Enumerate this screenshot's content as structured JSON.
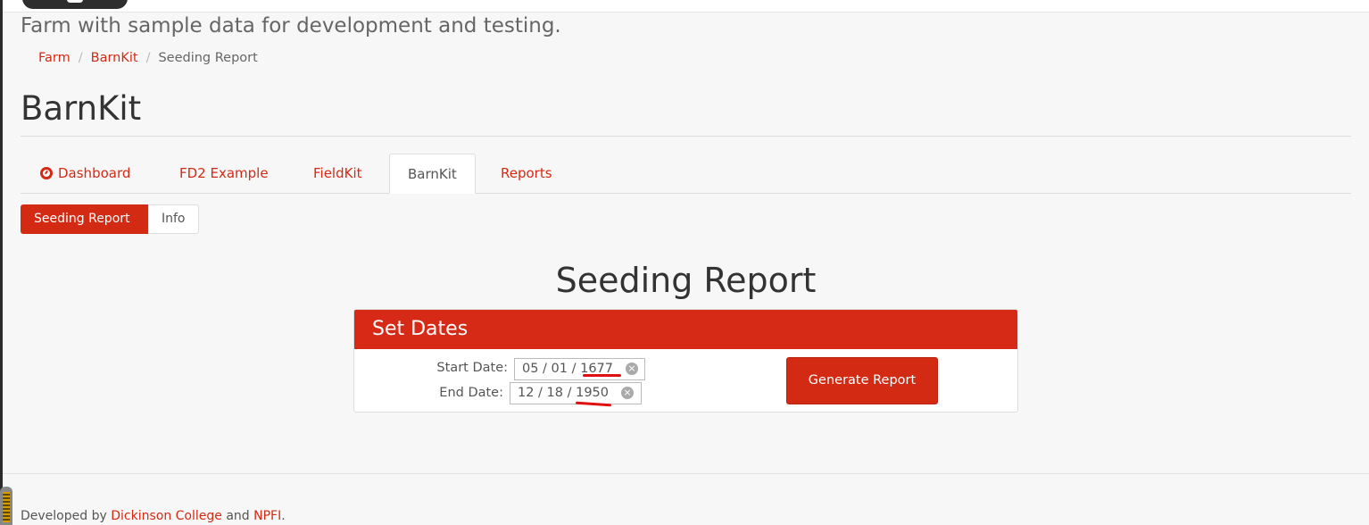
{
  "header": {
    "slogan": "Farm with sample data for development and testing."
  },
  "breadcrumb": {
    "items": [
      "Farm",
      "BarnKit"
    ],
    "current": "Seeding Report",
    "separator": "/"
  },
  "page_title": "BarnKit",
  "tabs": [
    {
      "label": "Dashboard",
      "icon": "dashboard-icon"
    },
    {
      "label": "FD2 Example"
    },
    {
      "label": "FieldKit"
    },
    {
      "label": "BarnKit",
      "active": true
    },
    {
      "label": "Reports"
    }
  ],
  "subnav": {
    "items": [
      "Seeding Report",
      "Info"
    ],
    "active": "Seeding Report"
  },
  "report": {
    "title": "Seeding Report",
    "panel_title": "Set Dates",
    "start_label": "Start Date:",
    "start_value": "05 / 01 / 1677",
    "end_label": "End Date:",
    "end_value": "12 / 18 / 1950",
    "button_label": "Generate Report"
  },
  "footer": {
    "prefix": "Developed by",
    "link1": "Dickinson College",
    "middle": "and",
    "link2": "NPFI",
    "suffix": "."
  },
  "colors": {
    "accent": "#d32a14",
    "annotation": "#e01010"
  }
}
